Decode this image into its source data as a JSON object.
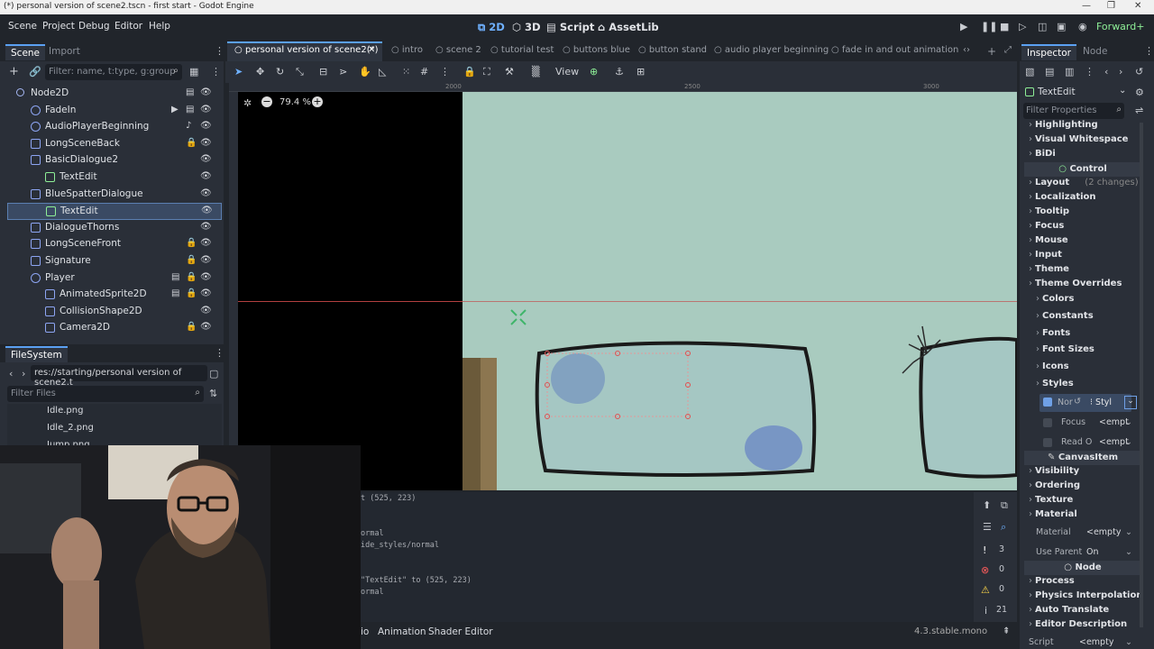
{
  "window": {
    "title": "(*) personal version of scene2.tscn - first start - Godot Engine"
  },
  "menu": {
    "items": [
      "Scene",
      "Project",
      "Debug",
      "Editor",
      "Help"
    ],
    "workspaces": [
      "2D",
      "3D",
      "Script",
      "AssetLib"
    ],
    "renderer": "Forward+"
  },
  "scene_dock": {
    "tabs": [
      "Scene",
      "Import"
    ],
    "filter_placeholder": "Filter: name, t:type, g:group",
    "nodes": [
      {
        "label": "Node2D",
        "indent": 0,
        "icon": "node2d"
      },
      {
        "label": "FadeIn",
        "indent": 1,
        "icon": "circle"
      },
      {
        "label": "AudioPlayerBeginning",
        "indent": 1,
        "icon": "circle"
      },
      {
        "label": "LongSceneBack",
        "indent": 1,
        "icon": "sprite"
      },
      {
        "label": "BasicDialogue2",
        "indent": 1,
        "icon": "sprite"
      },
      {
        "label": "TextEdit",
        "indent": 2,
        "icon": "control"
      },
      {
        "label": "BlueSpatterDialogue",
        "indent": 1,
        "icon": "sprite"
      },
      {
        "label": "TextEdit",
        "indent": 2,
        "icon": "control",
        "selected": true
      },
      {
        "label": "DialogueThorns",
        "indent": 1,
        "icon": "sprite"
      },
      {
        "label": "LongSceneFront",
        "indent": 1,
        "icon": "sprite"
      },
      {
        "label": "Signature",
        "indent": 1,
        "icon": "sprite"
      },
      {
        "label": "Player",
        "indent": 1,
        "icon": "body"
      },
      {
        "label": "AnimatedSprite2D",
        "indent": 2,
        "icon": "sprite"
      },
      {
        "label": "CollisionShape2D",
        "indent": 2,
        "icon": "shape"
      },
      {
        "label": "Camera2D",
        "indent": 2,
        "icon": "camera"
      }
    ]
  },
  "filesystem": {
    "title": "FileSystem",
    "path": "res://starting/personal version of scene2.t",
    "filter_placeholder": "Filter Files",
    "files": [
      "Idle.png",
      "Idle_2.png",
      "Jump.png"
    ]
  },
  "viewport": {
    "tabs": [
      "personal version of scene2(*)",
      "intro",
      "scene 2",
      "tutorial test",
      "buttons blue",
      "button stand",
      "audio player beginning",
      "fade in and out animation"
    ],
    "view_label": "View",
    "zoom": "79.4 %",
    "ruler_marks": [
      "2000",
      "2500",
      "3000"
    ]
  },
  "output": {
    "lines": [
      "t (525, 223)",
      "",
      "",
      "ormal",
      "ide_styles/normal",
      "",
      "",
      "\"TextEdit\" to (525, 223)",
      "ormal"
    ],
    "counts": [
      "3",
      "0",
      "0",
      "21"
    ]
  },
  "bottom_tabs": [
    "io",
    "Animation",
    "Shader Editor"
  ],
  "version": "4.3.stable.mono",
  "inspector": {
    "tabs": [
      "Inspector",
      "Node"
    ],
    "node_name": "TextEdit",
    "filter_placeholder": "Filter Properties",
    "sections_top": [
      "Highlighting",
      "Visual Whitespace",
      "BiDi"
    ],
    "control_header": "Control",
    "layout": "Layout",
    "layout_changes": "(2 changes)",
    "sections_mid": [
      "Localization",
      "Tooltip",
      "Focus",
      "Mouse",
      "Input",
      "Theme",
      "Theme Overrides"
    ],
    "overrides": [
      "Colors",
      "Constants",
      "Fonts",
      "Font Sizes",
      "Icons",
      "Styles"
    ],
    "style_normal_label": "Nor",
    "style_normal_value": "Styl",
    "style_focus_label": "Focus",
    "style_focus_value": "<empt",
    "style_readonly_label": "Read O",
    "style_readonly_value": "<empt",
    "canvasitem_header": "CanvasItem",
    "sections_ci": [
      "Visibility",
      "Ordering",
      "Texture",
      "Material"
    ],
    "material_label": "Material",
    "material_value": "<empty",
    "use_parent_label": "Use Parent",
    "use_parent_value": "On",
    "node_header": "Node",
    "sections_node": [
      "Process",
      "Physics Interpolation",
      "Auto Translate",
      "Editor Description"
    ],
    "script_label": "Script",
    "script_value": "<empty"
  },
  "colors": {
    "accent": "#5ba0f2",
    "selection": "#3a4a63",
    "scene_bg": "#a9cbbf"
  }
}
